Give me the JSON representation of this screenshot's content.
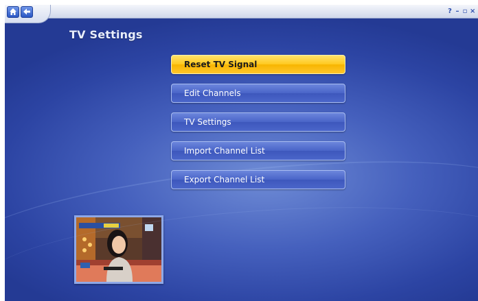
{
  "app": {
    "nav": {
      "home_icon": "home-icon",
      "back_icon": "back-arrow-icon"
    },
    "window_controls": {
      "help": "?",
      "minimize": "–",
      "restore": "▫",
      "close": "×"
    }
  },
  "page": {
    "title": "TV Settings"
  },
  "menu": {
    "items": [
      {
        "label": "Reset TV Signal",
        "selected": true
      },
      {
        "label": "Edit Channels",
        "selected": false
      },
      {
        "label": "TV Settings",
        "selected": false
      },
      {
        "label": "Import Channel List",
        "selected": false
      },
      {
        "label": "Export Channel List",
        "selected": false
      }
    ]
  },
  "colors": {
    "background": "#3a54b4",
    "button": "#4964c8",
    "button_selected": "#ffc81e",
    "title": "#e8eefc"
  }
}
